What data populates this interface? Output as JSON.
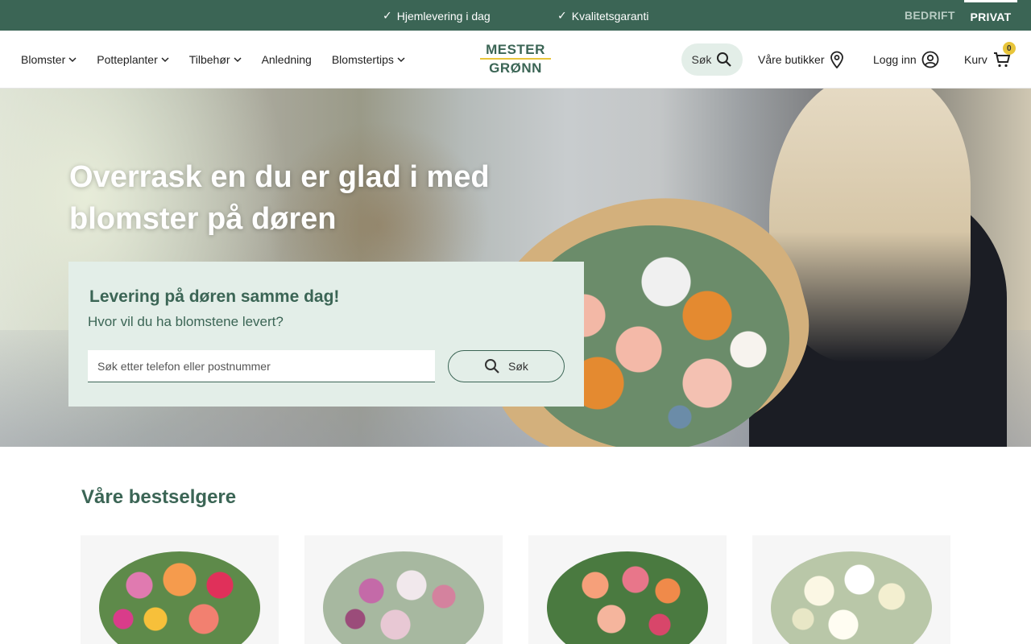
{
  "colors": {
    "brand_green": "#3b6555",
    "accent_yellow": "#e8c53a",
    "light_green": "#e3eee8",
    "segment_inactive": "#b7cbc2"
  },
  "topbar": {
    "usps": [
      {
        "icon": "check-icon",
        "text": "Hjemlevering i dag"
      },
      {
        "icon": "check-icon",
        "text": "Kvalitetsgaranti"
      }
    ],
    "segments": [
      {
        "label": "BEDRIFT",
        "active": false
      },
      {
        "label": "PRIVAT",
        "active": true
      }
    ]
  },
  "header": {
    "nav": [
      {
        "label": "Blomster",
        "has_dropdown": true
      },
      {
        "label": "Potteplanter",
        "has_dropdown": true
      },
      {
        "label": "Tilbehør",
        "has_dropdown": true
      },
      {
        "label": "Anledning",
        "has_dropdown": false
      },
      {
        "label": "Blomstertips",
        "has_dropdown": true
      }
    ],
    "logo": {
      "line1": "MESTER",
      "line2": "GRØNN"
    },
    "search_label": "Søk",
    "stores_label": "Våre butikker",
    "login_label": "Logg inn",
    "cart_label": "Kurv",
    "cart_count": "0"
  },
  "hero": {
    "title": "Overrask en du er glad i med blomster på døren",
    "box_title": "Levering på døren samme dag!",
    "box_subtitle": "Hvor vil du ha blomstene levert?",
    "input_placeholder": "Søk etter telefon eller postnummer",
    "button_label": "Søk"
  },
  "bestsellers": {
    "title": "Våre bestselgere",
    "products": [
      {
        "image": "colorful-bouquet"
      },
      {
        "image": "pink-purple-bouquet"
      },
      {
        "image": "orange-pink-rose-bouquet"
      },
      {
        "image": "white-bouquet"
      }
    ]
  }
}
